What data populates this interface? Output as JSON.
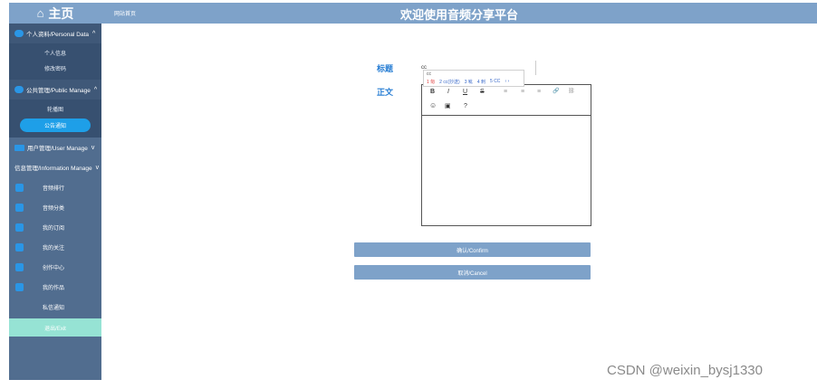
{
  "sidebar": {
    "logo_text": "主页",
    "groups": {
      "personal": {
        "label": "个人资料/Personal Data",
        "items": [
          "个人信息",
          "修改密码"
        ]
      },
      "public": {
        "label": "公共管理/Public Manage",
        "items": [
          "轮播图",
          "公告通知"
        ]
      },
      "user": {
        "label": "用户管理/User Manage"
      },
      "info": {
        "label": "信息管理/Information Manage"
      }
    },
    "nav": [
      "音频排行",
      "音频分类",
      "我的订阅",
      "我的关注",
      "创作中心",
      "我的作品",
      "私信通知"
    ],
    "logout": "退出/Exit"
  },
  "header": {
    "breadcrumb": "网站首页",
    "title": "欢迎使用音频分享平台"
  },
  "form": {
    "title_label": "标题",
    "title_value": "cc",
    "body_label": "正文",
    "ime": {
      "typed": "cc",
      "candidates": [
        "1 匆",
        "2 cc(抄送)",
        "3 呲",
        "4 刺",
        "5 CC"
      ],
      "pager": "‹ ›"
    },
    "toolbar": {
      "bold": "B",
      "italic": "I",
      "underline": "U",
      "strike": "S",
      "align_left": "≡",
      "align_center": "≡",
      "align_right": "≡",
      "link": "🔗",
      "unlink": "⛓",
      "emoji": "☺",
      "image": "▣",
      "help": "?"
    },
    "confirm_label": "确认/Confirm",
    "cancel_label": "取消/Cancel"
  },
  "watermark": "CSDN @weixin_bysj1330"
}
